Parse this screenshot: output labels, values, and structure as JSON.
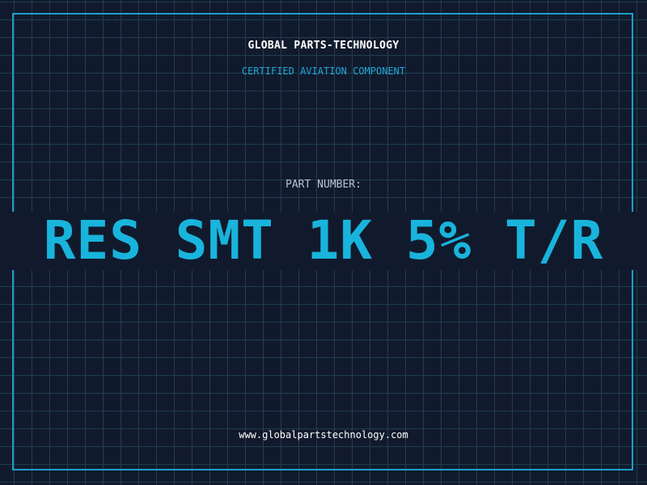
{
  "header": {
    "brand": "GLOBAL PARTS-TECHNOLOGY",
    "subtitle": "CERTIFIED AVIATION COMPONENT"
  },
  "part": {
    "label": "PART NUMBER:",
    "number": "RES SMT 1K 5% T/R"
  },
  "footer": {
    "url": "www.globalpartstechnology.com"
  },
  "colors": {
    "background": "#111a2c",
    "grid": "#1f3e52",
    "accent": "#1aa0c8",
    "part_number": "#18b4dc"
  }
}
